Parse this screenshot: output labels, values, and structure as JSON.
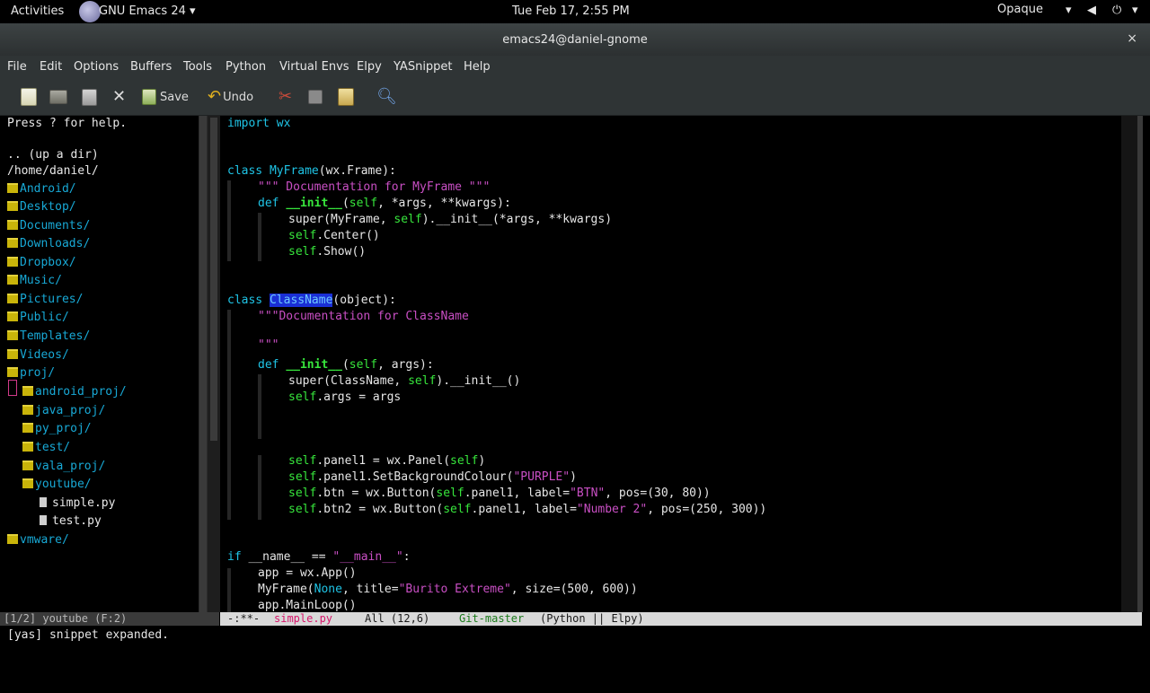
{
  "gnome_bar": {
    "activities": "Activities",
    "app_menu": "GNU Emacs 24 ▾",
    "clock": "Tue Feb 17,  2:55 PM",
    "theme_label": "Opaque",
    "tray_icons": [
      "network-icon",
      "volume-icon",
      "power-icon"
    ]
  },
  "window": {
    "title": "emacs24@daniel-gnome",
    "close": "×"
  },
  "menubar": [
    "File",
    "Edit",
    "Options",
    "Buffers",
    "Tools",
    "Python",
    "Virtual Envs",
    "Elpy",
    "YASnippet",
    "Help"
  ],
  "toolbar": {
    "save_label": "Save",
    "undo_label": "Undo"
  },
  "dired": {
    "help": "Press ? for help.",
    "up": ".. (up a dir)",
    "cwd": "/home/daniel/",
    "entries": [
      {
        "name": "Android/",
        "type": "dir"
      },
      {
        "name": "Desktop/",
        "type": "dir"
      },
      {
        "name": "Documents/",
        "type": "dir"
      },
      {
        "name": "Downloads/",
        "type": "dir"
      },
      {
        "name": "Dropbox/",
        "type": "dir"
      },
      {
        "name": "Music/",
        "type": "dir"
      },
      {
        "name": "Pictures/",
        "type": "dir"
      },
      {
        "name": "Public/",
        "type": "dir"
      },
      {
        "name": "Templates/",
        "type": "dir"
      },
      {
        "name": "Videos/",
        "type": "dir"
      },
      {
        "name": "proj/",
        "type": "dir"
      },
      {
        "name": "android_proj/",
        "type": "dir",
        "indent": 1
      },
      {
        "name": "java_proj/",
        "type": "dir",
        "indent": 1
      },
      {
        "name": "py_proj/",
        "type": "dir",
        "indent": 1
      },
      {
        "name": "test/",
        "type": "dir",
        "indent": 1
      },
      {
        "name": "vala_proj/",
        "type": "dir",
        "indent": 1
      },
      {
        "name": "youtube/",
        "type": "dir",
        "indent": 1
      },
      {
        "name": "simple.py",
        "type": "file",
        "indent": 2
      },
      {
        "name": "test.py",
        "type": "file",
        "indent": 2
      },
      {
        "name": "vmware/",
        "type": "dir"
      }
    ]
  },
  "code": {
    "l1": "import wx",
    "l2_kw": "class ",
    "l2_name": "MyFrame",
    "l2_rest": "(wx.Frame):",
    "l3": "\"\"\" Documentation for MyFrame \"\"\"",
    "l4_kw": "def ",
    "l4_fn": "__init__",
    "l4_a": "(",
    "l4_self": "self",
    "l4_b": ", *args, **kwargs):",
    "l5_a": "super(MyFrame, ",
    "l5_self": "self",
    "l5_b": ").__init__(*args, **kwargs)",
    "l6_self": "self",
    "l6_b": ".Center()",
    "l7_self": "self",
    "l7_b": ".Show()",
    "l8_kw": "class ",
    "l8_name": "ClassName",
    "l8_rest": "(object):",
    "l9": "\"\"\"Documentation for ClassName",
    "l10": "\"\"\"",
    "l11_kw": "def ",
    "l11_fn": "__init__",
    "l11_a": "(",
    "l11_self": "self",
    "l11_b": ", args):",
    "l12_a": "super(ClassName, ",
    "l12_self": "self",
    "l12_b": ").__init__()",
    "l13_self": "self",
    "l13_b": ".args = args",
    "l14_self": "self",
    "l14_a": ".panel1 = wx.Panel(",
    "l14_self2": "self",
    "l14_b": ")",
    "l15_self": "self",
    "l15_a": ".panel1.SetBackgroundColour(",
    "l15_str": "\"PURPLE\"",
    "l15_b": ")",
    "l16_self": "self",
    "l16_a": ".btn = wx.Button(",
    "l16_self2": "self",
    "l16_b": ".panel1, label=",
    "l16_str": "\"BTN\"",
    "l16_c": ", pos=(30, 80))",
    "l17_self": "self",
    "l17_a": ".btn2 = wx.Button(",
    "l17_self2": "self",
    "l17_b": ".panel1, label=",
    "l17_str": "\"Number 2\"",
    "l17_c": ", pos=(250, 300))",
    "l18_kw": "if ",
    "l18_a": "__name__ == ",
    "l18_str": "\"__main__\"",
    "l18_b": ":",
    "l19": "app = wx.App()",
    "l20_a": "MyFrame(",
    "l20_none": "None",
    "l20_b": ", title=",
    "l20_str": "\"Burito Extreme\"",
    "l20_c": ", size=(500, 600))",
    "l21": "app.MainLoop()"
  },
  "modeline_left": "[1/2] youtube (F:2)",
  "modeline_right": {
    "state": "-:**-",
    "buffer": "simple.py",
    "position": "All (12,6)",
    "git": "Git-master",
    "modes": "(Python || Elpy)"
  },
  "minibuffer": "[yas] snippet expanded."
}
